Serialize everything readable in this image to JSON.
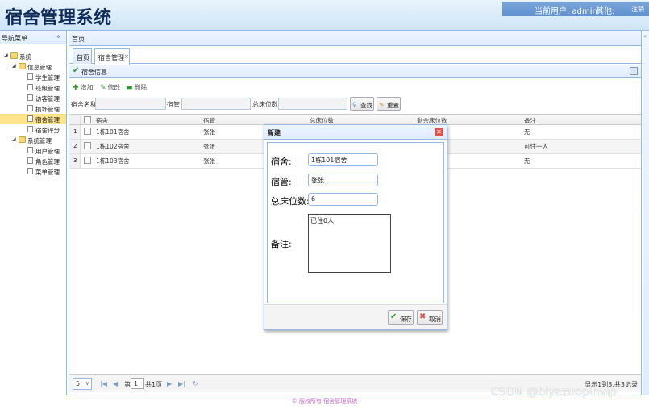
{
  "header": {
    "title": "宿舍管理系统",
    "current_user": "当前用户: admin",
    "other": "其他:",
    "logout": "注销"
  },
  "nav": {
    "title": "导航菜单",
    "tree": [
      {
        "label": "系统",
        "level": 0,
        "type": "folder"
      },
      {
        "label": "信息管理",
        "level": 1,
        "type": "folder"
      },
      {
        "label": "学生管理",
        "level": 2,
        "type": "file"
      },
      {
        "label": "班级管理",
        "level": 2,
        "type": "file"
      },
      {
        "label": "访客管理",
        "level": 2,
        "type": "file"
      },
      {
        "label": "损坏管理",
        "level": 2,
        "type": "file"
      },
      {
        "label": "宿舍管理",
        "level": 2,
        "type": "file",
        "selected": true
      },
      {
        "label": "宿舍评分",
        "level": 2,
        "type": "file"
      },
      {
        "label": "系统管理",
        "level": 1,
        "type": "folder"
      },
      {
        "label": "用户管理",
        "level": 2,
        "type": "file"
      },
      {
        "label": "角色管理",
        "level": 2,
        "type": "file"
      },
      {
        "label": "菜单管理",
        "level": 2,
        "type": "file"
      }
    ]
  },
  "center": {
    "title": "首页",
    "tabs": [
      {
        "label": "首页"
      },
      {
        "label": "宿舍管理",
        "close": "×"
      }
    ],
    "panel_title": "宿舍信息",
    "toolbar": {
      "add": "增加",
      "edit": "修改",
      "delete": "删除"
    },
    "search": {
      "name_label": "宿舍名称:",
      "manager_label": "宿管:",
      "beds_label": "总床位数:",
      "search_btn": "查找",
      "reset_btn": "重置"
    },
    "grid": {
      "columns": [
        "宿舍",
        "宿管",
        "总床位数",
        "剩余床位数",
        "备注"
      ],
      "rows": [
        {
          "no": "1",
          "name": "1栋101宿舍",
          "manager": "张张",
          "remark": "无"
        },
        {
          "no": "2",
          "name": "1栋102宿舍",
          "manager": "张张",
          "remark": "可住一人"
        },
        {
          "no": "3",
          "name": "1栋103宿舍",
          "manager": "张张",
          "remark": "无"
        }
      ]
    },
    "pager": {
      "page_size": "5",
      "page_prefix": "第",
      "page": "1",
      "page_suffix": "共1页",
      "info": "显示1到3,共3记录"
    }
  },
  "dialog": {
    "title": "新建",
    "fields": {
      "dorm_label": "宿舍:",
      "dorm_value": "1栋101宿舍",
      "manager_label": "宿管:",
      "manager_value": "张张",
      "beds_label": "总床位数:",
      "beds_value": "6",
      "remark_label": "备注:",
      "remark_value": "已住0人"
    },
    "save": "保存",
    "cancel": "取消"
  },
  "footer": "© 版权所有 宿舍管理系统",
  "watermark": "CSDN @biyezuopinvip"
}
